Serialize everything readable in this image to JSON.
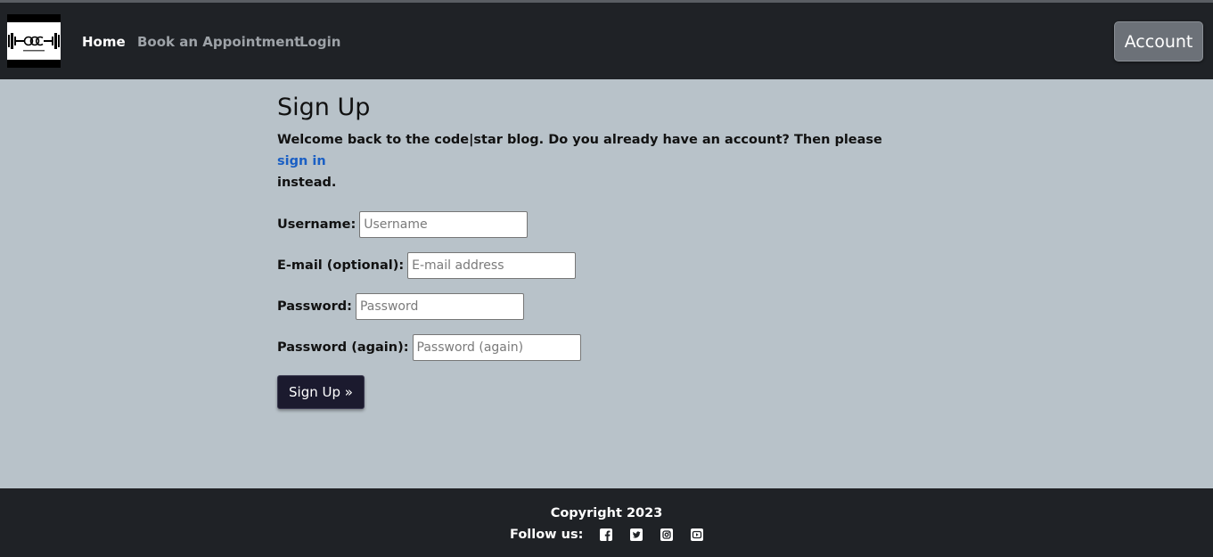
{
  "nav": {
    "home": "Home",
    "book": "Book an Appointment",
    "login": "Login",
    "account": "Account"
  },
  "main": {
    "title": "Sign Up",
    "welcome_text": "Welcome back to the code|star blog. Do you already have an account? Then please",
    "signin_link": "sign in",
    "welcome_tail": "instead."
  },
  "form": {
    "username_label": "Username:",
    "username_placeholder": "Username",
    "email_label": "E-mail (optional):",
    "email_placeholder": "E-mail address",
    "password_label": "Password:",
    "password_placeholder": "Password",
    "password2_label": "Password (again):",
    "password2_placeholder": "Password (again)",
    "submit_label": "Sign Up »"
  },
  "footer": {
    "copyright": "Copyright 2023",
    "follow": "Follow us:",
    "icons": [
      "facebook-icon",
      "twitter-icon",
      "instagram-icon",
      "youtube-icon"
    ]
  },
  "colors": {
    "navbar": "#1f2226",
    "page_bg": "#b8c2c9",
    "link": "#1a5fc4",
    "submit_bg": "#1b1a2e",
    "account_bg": "#6c7178"
  }
}
